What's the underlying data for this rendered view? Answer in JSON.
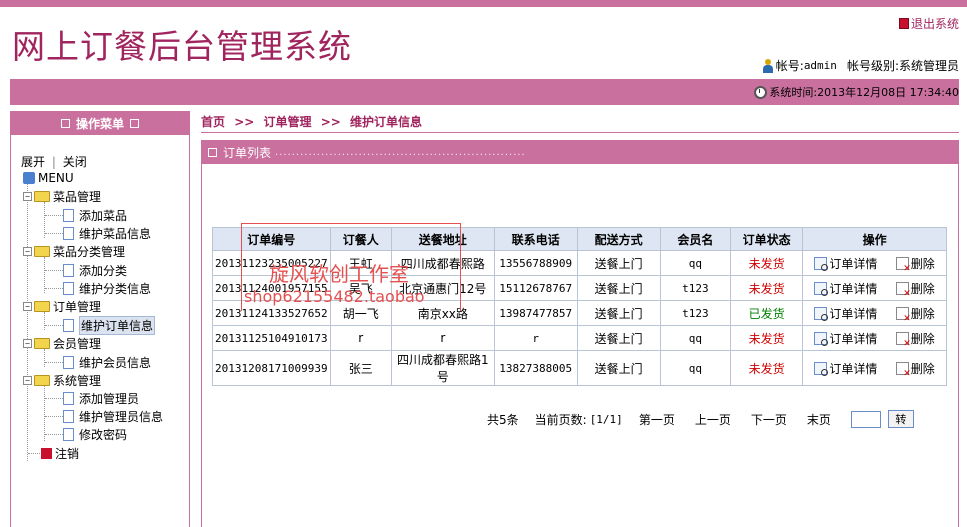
{
  "header": {
    "title": "网上订餐后台管理系统",
    "logout": "退出系统",
    "account_label": "帐号:",
    "account_value": "admin",
    "level_label": "帐号级别:",
    "level_value": "系统管理员",
    "time_label": "系统时间:",
    "time_value": "2013年12月08日 17:34:40"
  },
  "sidebar": {
    "heading": "操作菜单",
    "expand": "展开",
    "separator": "|",
    "collapse": "关闭",
    "root": "MENU",
    "groups": [
      {
        "label": "菜品管理",
        "items": [
          "添加菜品",
          "维护菜品信息"
        ]
      },
      {
        "label": "菜品分类管理",
        "items": [
          "添加分类",
          "维护分类信息"
        ]
      },
      {
        "label": "订单管理",
        "items": [
          "维护订单信息"
        ]
      },
      {
        "label": "会员管理",
        "items": [
          "维护会员信息"
        ]
      },
      {
        "label": "系统管理",
        "items": [
          "添加管理员",
          "维护管理员信息",
          "修改密码"
        ]
      }
    ],
    "logout": "注销",
    "selected": "维护订单信息"
  },
  "breadcrumb": {
    "home": "首页",
    "section": "订单管理",
    "page": "维护订单信息",
    "arrow": ">>"
  },
  "panel": {
    "title": "订单列表",
    "dots": "............................................................"
  },
  "table": {
    "headers": [
      "订单编号",
      "订餐人",
      "送餐地址",
      "联系电话",
      "配送方式",
      "会员名",
      "订单状态",
      "操作"
    ],
    "rows": [
      {
        "id": "20131123235005227",
        "name": "王虹",
        "address": "四川成都春熙路",
        "phone": "13556788909",
        "delivery": "送餐上门",
        "member": "qq",
        "status": "未发货"
      },
      {
        "id": "20131124001957155",
        "name": "吴飞",
        "address": "北京通惠门12号",
        "phone": "15112678767",
        "delivery": "送餐上门",
        "member": "t123",
        "status": "未发货"
      },
      {
        "id": "20131124133527652",
        "name": "胡一飞",
        "address": "南京xx路",
        "phone": "13987477857",
        "delivery": "送餐上门",
        "member": "t123",
        "status": "已发货"
      },
      {
        "id": "20131125104910173",
        "name": "r",
        "address": "r",
        "phone": "r",
        "delivery": "送餐上门",
        "member": "qq",
        "status": "未发货"
      },
      {
        "id": "20131208171009939",
        "name": "张三",
        "address": "四川成都春熙路1号",
        "phone": "13827388005",
        "delivery": "送餐上门",
        "member": "qq",
        "status": "未发货"
      }
    ],
    "op_view": "订单详情",
    "op_delete": "删除"
  },
  "pager": {
    "total": "共5条",
    "current_label": "当前页数:",
    "current_value": "[1/1]",
    "first": "第一页",
    "prev": "上一页",
    "next": "下一页",
    "last": "末页",
    "go": "转"
  },
  "watermark": {
    "line1": "旋风软创工作室",
    "line2": "shop62155482.taobao"
  },
  "colors": {
    "brand": "#c9709e",
    "title": "#a0245e",
    "unshipped": "#d00000",
    "shipped": "#008000"
  }
}
